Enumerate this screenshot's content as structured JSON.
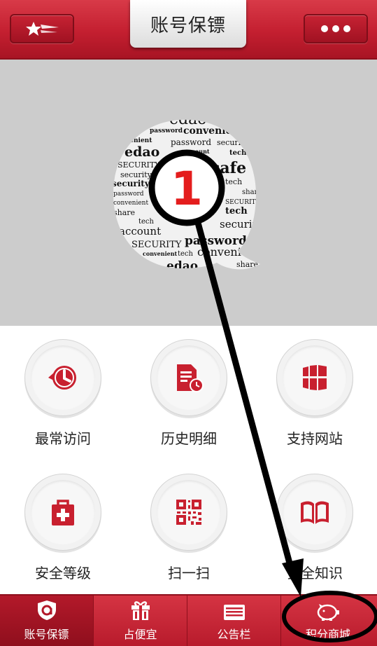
{
  "header": {
    "title": "账号保镖",
    "left_icon": "shooting-star-icon",
    "right_icon": "more-dots-icon"
  },
  "banner": {
    "words": [
      "edao",
      "share",
      "password",
      "convenient",
      "convenient",
      "password",
      "security",
      "edao",
      "account",
      "tech",
      "SECURITY",
      "safe",
      "security",
      "tech",
      "security",
      "password",
      "share",
      "convenient",
      "SECURITY",
      "share",
      "tech",
      "tech",
      "security",
      "account",
      "SECURITY",
      "password",
      "convenient",
      "tech",
      "convenient",
      "edao",
      "share"
    ]
  },
  "grid": [
    {
      "label": "最常访问",
      "icon": "history-clock-icon"
    },
    {
      "label": "历史明细",
      "icon": "document-clock-icon"
    },
    {
      "label": "支持网站",
      "icon": "windows-grid-icon"
    },
    {
      "label": "安全等级",
      "icon": "medical-bag-icon"
    },
    {
      "label": "扫一扫",
      "icon": "qr-code-icon"
    },
    {
      "label": "安全知识",
      "icon": "open-book-icon"
    }
  ],
  "nav": [
    {
      "label": "账号保镖",
      "icon": "shield-icon",
      "active": true
    },
    {
      "label": "占便宜",
      "icon": "gift-icon",
      "active": false
    },
    {
      "label": "公告栏",
      "icon": "bulletin-icon",
      "active": false
    },
    {
      "label": "积分商城",
      "icon": "piggy-bank-icon",
      "active": false
    }
  ],
  "annotation": {
    "step_number": "1"
  },
  "colors": {
    "brand_red": "#c41f30",
    "banner_gray": "#cccccc"
  }
}
